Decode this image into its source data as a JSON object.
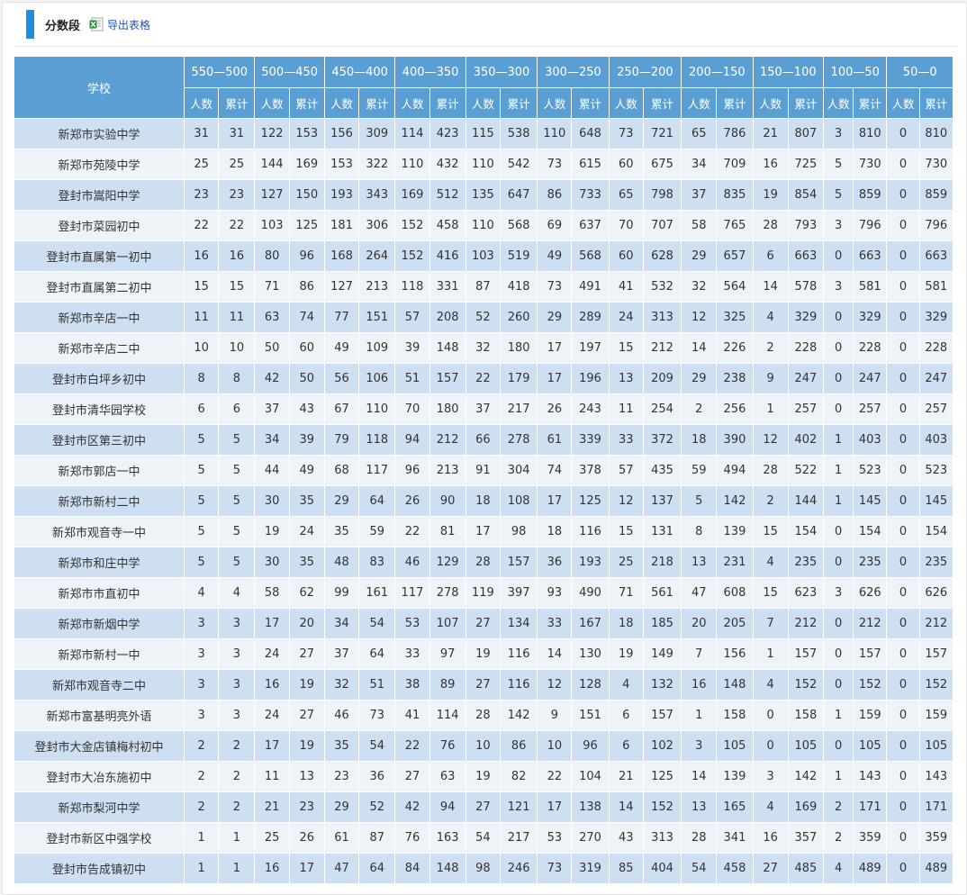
{
  "header": {
    "title": "分数段",
    "export_label": "导出表格",
    "excel_icon": "excel-file-icon"
  },
  "colors": {
    "accent_bar": "#1b8fe0",
    "table_header": "#5a9fd4",
    "row_odd": "#cfdff2",
    "row_even": "#eef3f8",
    "link": "#1f4fbf"
  },
  "table": {
    "school_header": "学校",
    "ranges": [
      "550—500",
      "500—450",
      "450—400",
      "400—350",
      "350—300",
      "300—250",
      "250—200",
      "200—150",
      "150—100",
      "100—50",
      "50—0"
    ],
    "sub_count": "人数",
    "sub_cum": "累计",
    "rows": [
      {
        "school": "新郑市实验中学",
        "values": [
          31,
          31,
          122,
          153,
          156,
          309,
          114,
          423,
          115,
          538,
          110,
          648,
          73,
          721,
          65,
          786,
          21,
          807,
          3,
          810,
          0,
          810
        ]
      },
      {
        "school": "新郑市苑陵中学",
        "values": [
          25,
          25,
          144,
          169,
          153,
          322,
          110,
          432,
          110,
          542,
          73,
          615,
          60,
          675,
          34,
          709,
          16,
          725,
          5,
          730,
          0,
          730
        ]
      },
      {
        "school": "登封市嵩阳中学",
        "values": [
          23,
          23,
          127,
          150,
          193,
          343,
          169,
          512,
          135,
          647,
          86,
          733,
          65,
          798,
          37,
          835,
          19,
          854,
          5,
          859,
          0,
          859
        ]
      },
      {
        "school": "登封市菜园初中",
        "values": [
          22,
          22,
          103,
          125,
          181,
          306,
          152,
          458,
          110,
          568,
          69,
          637,
          70,
          707,
          58,
          765,
          28,
          793,
          3,
          796,
          0,
          796
        ]
      },
      {
        "school": "登封市直属第一初中",
        "values": [
          16,
          16,
          80,
          96,
          168,
          264,
          152,
          416,
          103,
          519,
          49,
          568,
          60,
          628,
          29,
          657,
          6,
          663,
          0,
          663,
          0,
          663
        ]
      },
      {
        "school": "登封市直属第二初中",
        "values": [
          15,
          15,
          71,
          86,
          127,
          213,
          118,
          331,
          87,
          418,
          73,
          491,
          41,
          532,
          32,
          564,
          14,
          578,
          3,
          581,
          0,
          581
        ]
      },
      {
        "school": "新郑市辛店一中",
        "values": [
          11,
          11,
          63,
          74,
          77,
          151,
          57,
          208,
          52,
          260,
          29,
          289,
          24,
          313,
          12,
          325,
          4,
          329,
          0,
          329,
          0,
          329
        ]
      },
      {
        "school": "新郑市辛店二中",
        "values": [
          10,
          10,
          50,
          60,
          49,
          109,
          39,
          148,
          32,
          180,
          17,
          197,
          15,
          212,
          14,
          226,
          2,
          228,
          0,
          228,
          0,
          228
        ]
      },
      {
        "school": "登封市白坪乡初中",
        "values": [
          8,
          8,
          42,
          50,
          56,
          106,
          51,
          157,
          22,
          179,
          17,
          196,
          13,
          209,
          29,
          238,
          9,
          247,
          0,
          247,
          0,
          247
        ]
      },
      {
        "school": "登封市清华园学校",
        "values": [
          6,
          6,
          37,
          43,
          67,
          110,
          70,
          180,
          37,
          217,
          26,
          243,
          11,
          254,
          2,
          256,
          1,
          257,
          0,
          257,
          0,
          257
        ]
      },
      {
        "school": "登封市区第三初中",
        "values": [
          5,
          5,
          34,
          39,
          79,
          118,
          94,
          212,
          66,
          278,
          61,
          339,
          33,
          372,
          18,
          390,
          12,
          402,
          1,
          403,
          0,
          403
        ]
      },
      {
        "school": "新郑市郭店一中",
        "values": [
          5,
          5,
          44,
          49,
          68,
          117,
          96,
          213,
          91,
          304,
          74,
          378,
          57,
          435,
          59,
          494,
          28,
          522,
          1,
          523,
          0,
          523
        ]
      },
      {
        "school": "新郑市新村二中",
        "values": [
          5,
          5,
          30,
          35,
          29,
          64,
          26,
          90,
          18,
          108,
          17,
          125,
          12,
          137,
          5,
          142,
          2,
          144,
          1,
          145,
          0,
          145
        ]
      },
      {
        "school": "新郑市观音寺一中",
        "values": [
          5,
          5,
          19,
          24,
          35,
          59,
          22,
          81,
          17,
          98,
          18,
          116,
          15,
          131,
          8,
          139,
          15,
          154,
          0,
          154,
          0,
          154
        ]
      },
      {
        "school": "新郑市和庄中学",
        "values": [
          5,
          5,
          30,
          35,
          48,
          83,
          46,
          129,
          28,
          157,
          36,
          193,
          25,
          218,
          13,
          231,
          4,
          235,
          0,
          235,
          0,
          235
        ]
      },
      {
        "school": "新郑市市直初中",
        "values": [
          4,
          4,
          58,
          62,
          99,
          161,
          117,
          278,
          119,
          397,
          93,
          490,
          71,
          561,
          47,
          608,
          15,
          623,
          3,
          626,
          0,
          626
        ]
      },
      {
        "school": "新郑市新烟中学",
        "values": [
          3,
          3,
          17,
          20,
          34,
          54,
          53,
          107,
          27,
          134,
          33,
          167,
          18,
          185,
          20,
          205,
          7,
          212,
          0,
          212,
          0,
          212
        ]
      },
      {
        "school": "新郑市新村一中",
        "values": [
          3,
          3,
          24,
          27,
          37,
          64,
          33,
          97,
          19,
          116,
          14,
          130,
          19,
          149,
          7,
          156,
          1,
          157,
          0,
          157,
          0,
          157
        ]
      },
      {
        "school": "新郑市观音寺二中",
        "values": [
          3,
          3,
          16,
          19,
          32,
          51,
          38,
          89,
          27,
          116,
          12,
          128,
          4,
          132,
          16,
          148,
          4,
          152,
          0,
          152,
          0,
          152
        ]
      },
      {
        "school": "新郑市富基明亮外语",
        "values": [
          3,
          3,
          24,
          27,
          46,
          73,
          41,
          114,
          28,
          142,
          9,
          151,
          6,
          157,
          1,
          158,
          0,
          158,
          1,
          159,
          0,
          159
        ]
      },
      {
        "school": "登封市大金店镇梅村初中",
        "values": [
          2,
          2,
          17,
          19,
          35,
          54,
          22,
          76,
          10,
          86,
          10,
          96,
          6,
          102,
          3,
          105,
          0,
          105,
          0,
          105,
          0,
          105
        ]
      },
      {
        "school": "登封市大冶东施初中",
        "values": [
          2,
          2,
          11,
          13,
          23,
          36,
          27,
          63,
          19,
          82,
          22,
          104,
          21,
          125,
          14,
          139,
          3,
          142,
          1,
          143,
          0,
          143
        ]
      },
      {
        "school": "新郑市梨河中学",
        "values": [
          2,
          2,
          21,
          23,
          29,
          52,
          42,
          94,
          27,
          121,
          17,
          138,
          14,
          152,
          13,
          165,
          4,
          169,
          2,
          171,
          0,
          171
        ]
      },
      {
        "school": "登封市新区中强学校",
        "values": [
          1,
          1,
          25,
          26,
          61,
          87,
          76,
          163,
          54,
          217,
          53,
          270,
          43,
          313,
          28,
          341,
          16,
          357,
          2,
          359,
          0,
          359
        ]
      },
      {
        "school": "登封市告成镇初中",
        "values": [
          1,
          1,
          16,
          17,
          47,
          64,
          84,
          148,
          98,
          246,
          73,
          319,
          85,
          404,
          54,
          458,
          27,
          485,
          4,
          489,
          0,
          489
        ]
      }
    ]
  }
}
